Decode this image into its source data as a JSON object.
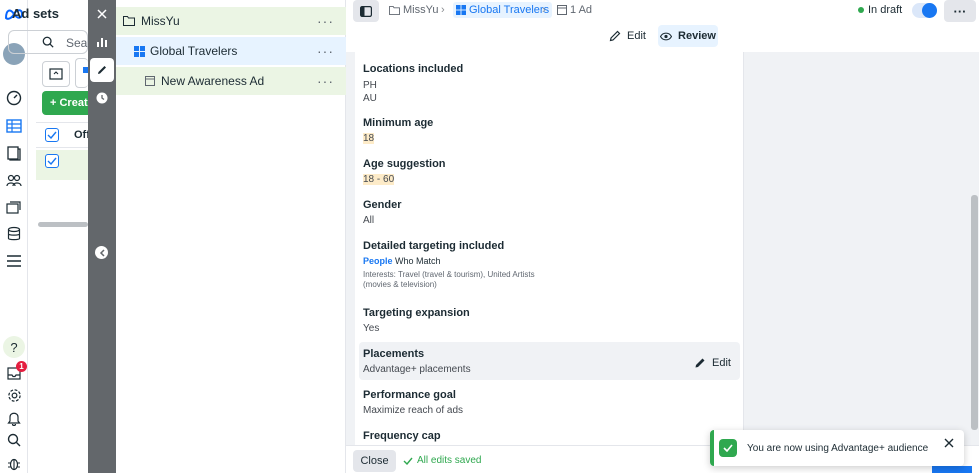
{
  "adsets_panel": {
    "title": "Ad sets",
    "search_placeholder": "Sear",
    "create_label": "+ Creat",
    "column_off": "Off"
  },
  "tree": {
    "campaign": "MissYu",
    "adset": "Global Travelers",
    "ad": "New Awareness Ad",
    "more": "···"
  },
  "breadcrumb": {
    "campaign": "MissYu",
    "adset": "Global Travelers",
    "ads": "1 Ad"
  },
  "status": {
    "label": "In draft",
    "more": "···"
  },
  "actions": {
    "edit": "Edit",
    "review": "Review"
  },
  "fields": {
    "locations_title": "Locations included",
    "location_1": "PH",
    "location_2": "AU",
    "min_age_title": "Minimum age",
    "min_age": "18",
    "age_suggestion_title": "Age suggestion",
    "age_suggestion": "18 - 60",
    "gender_title": "Gender",
    "gender": "All",
    "detailed_title": "Detailed targeting included",
    "people_label": "People",
    "who_match": " Who Match",
    "interests_1": "Interests: Travel (travel & tourism), United Artists",
    "interests_2": "(movies & television)",
    "expansion_title": "Targeting expansion",
    "expansion": "Yes",
    "placements_title": "Placements",
    "placements": "Advantage+ placements",
    "placements_edit": "Edit",
    "goal_title": "Performance goal",
    "goal": "Maximize reach of ads",
    "frequency_title": "Frequency cap"
  },
  "footer": {
    "close": "Close",
    "saved": "All edits saved"
  },
  "toast": {
    "message": "You are now using Advantage+ audience"
  },
  "rail": {
    "notification_count": "1"
  },
  "colors": {
    "accent": "#1877f2",
    "success": "#2fa84f",
    "highlight": "#fdebc8"
  }
}
